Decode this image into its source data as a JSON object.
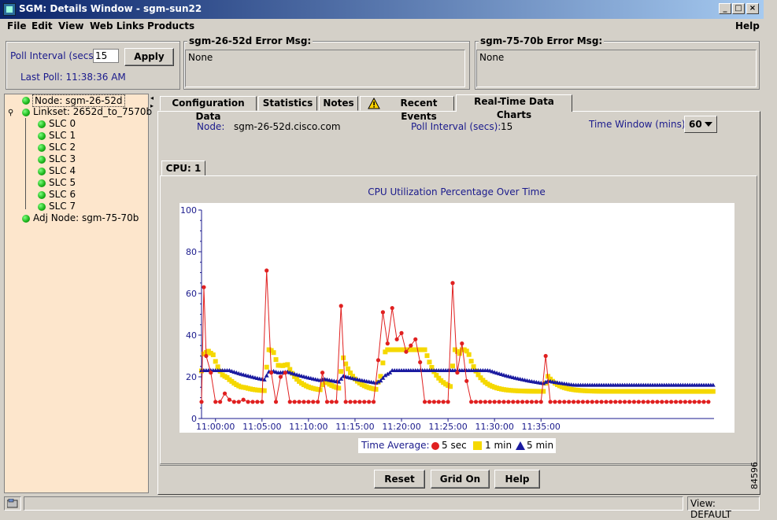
{
  "window": {
    "title": "SGM: Details Window - sgm-sun22"
  },
  "menu": {
    "file": "File",
    "edit": "Edit",
    "view": "View",
    "web_links": "Web Links",
    "products": "Products",
    "help": "Help"
  },
  "poll": {
    "label": "Poll Interval (secs)",
    "value": "15",
    "apply": "Apply",
    "last_poll": "Last Poll:  11:38:36 AM"
  },
  "errors": [
    {
      "title": "sgm-26-52d  Error Msg:",
      "message": "None"
    },
    {
      "title": "sgm-75-70b  Error Msg:",
      "message": "None"
    }
  ],
  "tree": {
    "node": "Node: sgm-26-52d",
    "linkset": "Linkset: 2652d_to_7570b",
    "slcs": [
      "SLC 0",
      "SLC 1",
      "SLC 2",
      "SLC 3",
      "SLC 4",
      "SLC 5",
      "SLC 6",
      "SLC 7"
    ],
    "adj_node": "Adj Node: sgm-75-70b"
  },
  "tabs": [
    "Configuration Data",
    "Statistics",
    "Notes",
    "Recent Events",
    "Real-Time Data Charts"
  ],
  "info": {
    "node_label": "Node:",
    "node_value": "sgm-26-52d.cisco.com",
    "poll_label": "Poll Interval (secs):",
    "poll_value": "15",
    "time_window_label": "Time Window (mins):",
    "time_window_value": "60"
  },
  "subtab": "CPU: 1",
  "buttons": {
    "reset": "Reset",
    "grid": "Grid On",
    "help": "Help"
  },
  "status": {
    "view": "View: DEFAULT"
  },
  "figure_id": "84596",
  "colors": {
    "s5": "#e02020",
    "m1": "#f5d800",
    "m5": "#1a1aa0",
    "tree_bg": "#fde6cc",
    "label_blue": "#1a1a8c"
  },
  "chart_data": {
    "type": "line",
    "title": "CPU Utilization Percentage Over Time",
    "ylim": [
      0,
      100
    ],
    "yticks": [
      0,
      20,
      40,
      60,
      80,
      100
    ],
    "xlim_min": [
      -1.5,
      53.6
    ],
    "xticks": [
      "11:00:00",
      "11:05:00",
      "11:10:00",
      "11:15:00",
      "11:20:00",
      "11:25:00",
      "11:30:00",
      "11:35:00"
    ],
    "xtick_min": [
      0,
      5,
      10,
      15,
      20,
      25,
      30,
      35
    ],
    "grid": false,
    "legend": {
      "title": "Time Average:",
      "position": "bottom"
    },
    "series": [
      {
        "name": "5 sec",
        "marker": "circle",
        "points": [
          [
            -1.5,
            8
          ],
          [
            -1.25,
            63
          ],
          [
            -1,
            30
          ],
          [
            -0.5,
            22
          ],
          [
            0,
            8
          ],
          [
            0.5,
            8
          ],
          [
            1,
            12
          ],
          [
            1.5,
            9
          ],
          [
            2,
            8
          ],
          [
            2.5,
            8
          ],
          [
            3,
            9
          ],
          [
            3.5,
            8
          ],
          [
            4,
            8
          ],
          [
            4.5,
            8
          ],
          [
            5,
            8
          ],
          [
            5.5,
            71
          ],
          [
            6,
            22
          ],
          [
            6.5,
            8
          ],
          [
            7,
            20
          ],
          [
            7.5,
            22
          ],
          [
            8,
            8
          ],
          [
            8.5,
            8
          ],
          [
            9,
            8
          ],
          [
            9.5,
            8
          ],
          [
            10,
            8
          ],
          [
            10.5,
            8
          ],
          [
            11,
            8
          ],
          [
            11.5,
            22
          ],
          [
            12,
            8
          ],
          [
            12.5,
            8
          ],
          [
            13,
            8
          ],
          [
            13.5,
            54
          ],
          [
            14,
            8
          ],
          [
            14.5,
            8
          ],
          [
            15,
            8
          ],
          [
            15.5,
            8
          ],
          [
            16,
            8
          ],
          [
            16.5,
            8
          ],
          [
            17,
            8
          ],
          [
            17.5,
            28
          ],
          [
            18,
            51
          ],
          [
            18.5,
            36
          ],
          [
            19,
            53
          ],
          [
            19.5,
            38
          ],
          [
            20,
            41
          ],
          [
            20.5,
            32
          ],
          [
            21,
            35
          ],
          [
            21.5,
            38
          ],
          [
            22,
            27
          ],
          [
            22.5,
            8
          ],
          [
            23,
            8
          ],
          [
            23.5,
            8
          ],
          [
            24,
            8
          ],
          [
            24.5,
            8
          ],
          [
            25,
            8
          ],
          [
            25.5,
            65
          ],
          [
            26,
            22
          ],
          [
            26.5,
            36
          ],
          [
            27,
            18
          ],
          [
            27.5,
            8
          ],
          [
            28,
            8
          ],
          [
            28.5,
            8
          ],
          [
            29,
            8
          ],
          [
            29.5,
            8
          ],
          [
            30,
            8
          ],
          [
            30.5,
            8
          ],
          [
            31,
            8
          ],
          [
            31.5,
            8
          ],
          [
            32,
            8
          ],
          [
            32.5,
            8
          ],
          [
            33,
            8
          ],
          [
            33.5,
            8
          ],
          [
            34,
            8
          ],
          [
            34.5,
            8
          ],
          [
            35,
            8
          ],
          [
            35.5,
            30
          ],
          [
            36,
            8
          ],
          [
            36.5,
            8
          ],
          [
            37,
            8
          ],
          [
            37.5,
            8
          ],
          [
            38,
            8
          ],
          [
            38.5,
            8
          ],
          [
            39,
            8
          ],
          [
            39.5,
            8
          ],
          [
            40,
            8
          ],
          [
            40.5,
            8
          ],
          [
            41,
            8
          ],
          [
            41.5,
            8
          ],
          [
            42,
            8
          ],
          [
            42.5,
            8
          ],
          [
            43,
            8
          ],
          [
            43.5,
            8
          ],
          [
            44,
            8
          ],
          [
            44.5,
            8
          ],
          [
            45,
            8
          ],
          [
            45.5,
            8
          ],
          [
            46,
            8
          ],
          [
            46.5,
            8
          ],
          [
            47,
            8
          ],
          [
            47.5,
            8
          ],
          [
            48,
            8
          ],
          [
            48.5,
            8
          ],
          [
            49,
            8
          ],
          [
            49.5,
            8
          ],
          [
            50,
            8
          ],
          [
            50.5,
            8
          ],
          [
            51,
            8
          ],
          [
            51.5,
            8
          ],
          [
            52,
            8
          ],
          [
            52.5,
            8
          ],
          [
            53,
            8
          ]
        ]
      },
      {
        "name": "1 min",
        "marker": "square",
        "values_note": ""
      },
      {
        "name": "5 min",
        "marker": "triangle"
      }
    ]
  }
}
